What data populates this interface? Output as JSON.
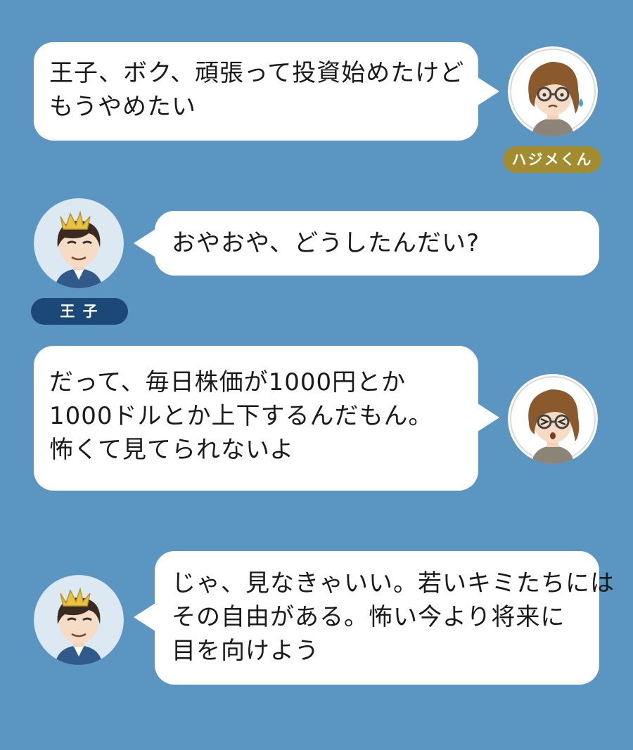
{
  "colors": {
    "background": "#5b95c1",
    "bubble": "#ffffff",
    "hajime_tag": "#a28c2e",
    "prince_tag": "#1c4878"
  },
  "speakers": {
    "hajime": {
      "name": "ハジメくん",
      "icon": "glasses-boy-icon"
    },
    "prince": {
      "name": "王 子",
      "icon": "crowned-prince-icon"
    }
  },
  "messages": [
    {
      "speaker": "hajime",
      "lines": [
        "王子、ボク、頑張って投資始めたけど",
        "もうやめたい"
      ]
    },
    {
      "speaker": "prince",
      "lines": [
        "おやおや、どうしたんだい?"
      ]
    },
    {
      "speaker": "hajime",
      "lines": [
        "だって、毎日株価が1000円とか",
        "1000ドルとか上下するんだもん。",
        "怖くて見てられないよ"
      ]
    },
    {
      "speaker": "prince",
      "lines": [
        "じゃ、見なきゃいい。若いキミたちには",
        "その自由がある。怖い今より将来に",
        "目を向けよう"
      ]
    }
  ]
}
